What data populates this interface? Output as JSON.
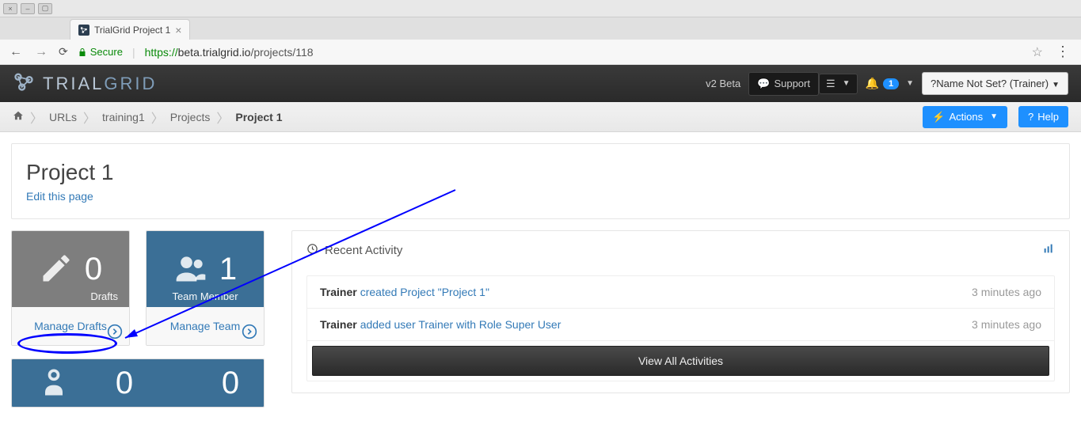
{
  "window": {
    "tab_title": "TrialGrid Project 1"
  },
  "addressbar": {
    "secure_label": "Secure",
    "proto": "https://",
    "host": "beta.trialgrid.io",
    "path": "/projects/118"
  },
  "brand": {
    "part1": "TRIAL",
    "part2": "GRID"
  },
  "topnav": {
    "beta": "v2 Beta",
    "support": "Support",
    "notif_count": "1",
    "user": "?Name Not Set? (Trainer)"
  },
  "breadcrumbs": {
    "items": [
      "URLs",
      "training1",
      "Projects",
      "Project 1"
    ],
    "actions": "Actions",
    "help": "Help"
  },
  "project": {
    "title": "Project 1",
    "edit": "Edit this page"
  },
  "tiles": {
    "drafts": {
      "count": "0",
      "label": "Drafts",
      "action": "Manage Drafts"
    },
    "team": {
      "count": "1",
      "label": "Team Member",
      "action": "Manage Team"
    },
    "extra": {
      "count1": "0",
      "count2": "0"
    }
  },
  "activity": {
    "heading": "Recent Activity",
    "items": [
      {
        "user": "Trainer",
        "text": "created Project \"Project 1\"",
        "time": "3 minutes ago"
      },
      {
        "user": "Trainer",
        "text": "added user Trainer with Role Super User",
        "time": "3 minutes ago"
      }
    ],
    "view_all": "View All Activities"
  }
}
